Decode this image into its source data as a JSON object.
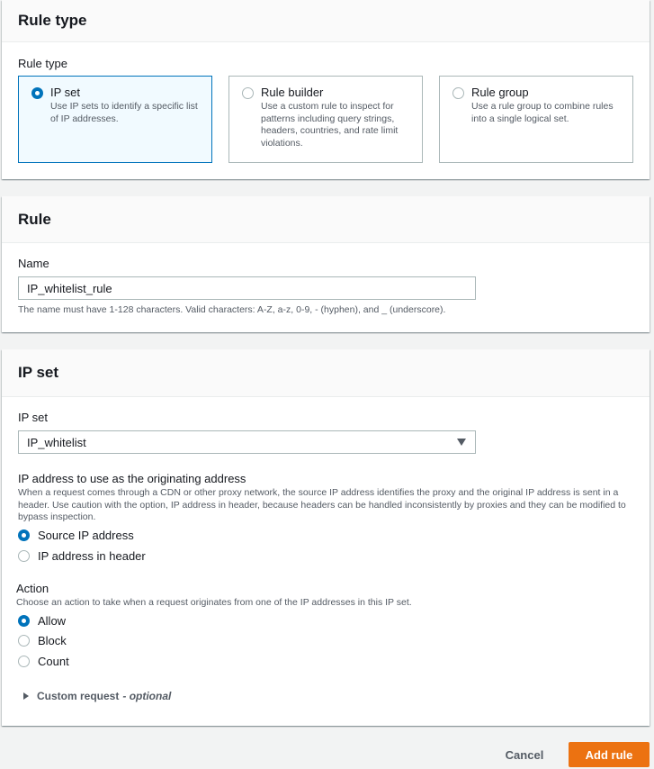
{
  "rule_type_panel": {
    "title": "Rule type",
    "field_label": "Rule type",
    "options": [
      {
        "title": "IP set",
        "description": "Use IP sets to identify a specific list of IP addresses.",
        "selected": true
      },
      {
        "title": "Rule builder",
        "description": "Use a custom rule to inspect for patterns including query strings, headers, countries, and rate limit violations.",
        "selected": false
      },
      {
        "title": "Rule group",
        "description": "Use a rule group to combine rules into a single logical set.",
        "selected": false
      }
    ]
  },
  "rule_panel": {
    "title": "Rule",
    "name_label": "Name",
    "name_value": "IP_whitelist_rule",
    "name_constraint": "The name must have 1-128 characters. Valid characters: A-Z, a-z, 0-9, - (hyphen), and _ (underscore)."
  },
  "ip_set_panel": {
    "title": "IP set",
    "ip_set_label": "IP set",
    "ip_set_value": "IP_whitelist",
    "origin_label": "IP address to use as the originating address",
    "origin_description": "When a request comes through a CDN or other proxy network, the source IP address identifies the proxy and the original IP address is sent in a header. Use caution with the option, IP address in header, because headers can be handled inconsistently by proxies and they can be modified to bypass inspection.",
    "origin_options": [
      {
        "label": "Source IP address",
        "selected": true
      },
      {
        "label": "IP address in header",
        "selected": false
      }
    ],
    "action_label": "Action",
    "action_description": "Choose an action to take when a request originates from one of the IP addresses in this IP set.",
    "action_options": [
      {
        "label": "Allow",
        "selected": true
      },
      {
        "label": "Block",
        "selected": false
      },
      {
        "label": "Count",
        "selected": false
      }
    ],
    "custom_request_label": "Custom request",
    "custom_request_optional": "- optional"
  },
  "footer": {
    "cancel_label": "Cancel",
    "add_rule_label": "Add rule"
  },
  "colors": {
    "accent_blue": "#0073bb",
    "primary_orange": "#ec7211",
    "border_gray": "#aab7b8",
    "text_secondary": "#545b64"
  }
}
